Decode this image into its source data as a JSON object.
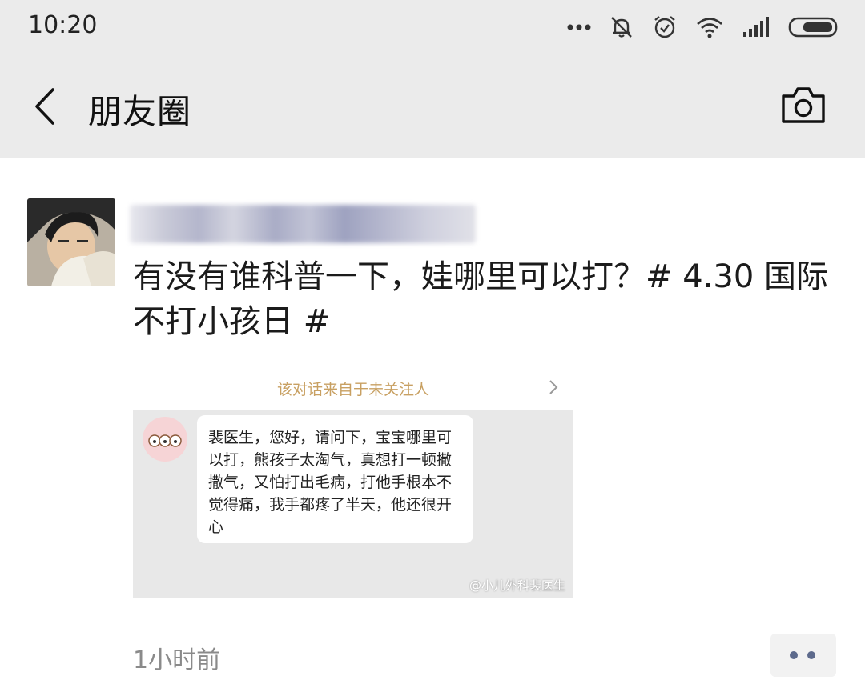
{
  "status_bar": {
    "time": "10:20",
    "icons": [
      "more-dots-icon",
      "bell-off-icon",
      "alarm-clock-icon",
      "wifi-icon",
      "signal-icon",
      "battery-icon"
    ]
  },
  "nav": {
    "back_icon": "chevron-left-icon",
    "title": "朋友圈",
    "camera_icon": "camera-icon"
  },
  "post": {
    "text": "有没有谁科普一下，娃哪里可以打？# 4.30 国际不打小孩日 #",
    "image": {
      "header": "该对话来自于未关注人",
      "message": "裴医生，您好，请问下，宝宝哪里可以打，熊孩子太淘气，真想打一顿撒撒气，又怕打出毛病，打他手根本不觉得痛，我手都疼了半天，他还很开心",
      "watermark": "@小儿外科裴医生"
    },
    "time_ago": "1小时前"
  },
  "colors": {
    "bar_bg": "#ebebeb",
    "header_text": "#c8a062",
    "dots": "#5d6a8c"
  }
}
